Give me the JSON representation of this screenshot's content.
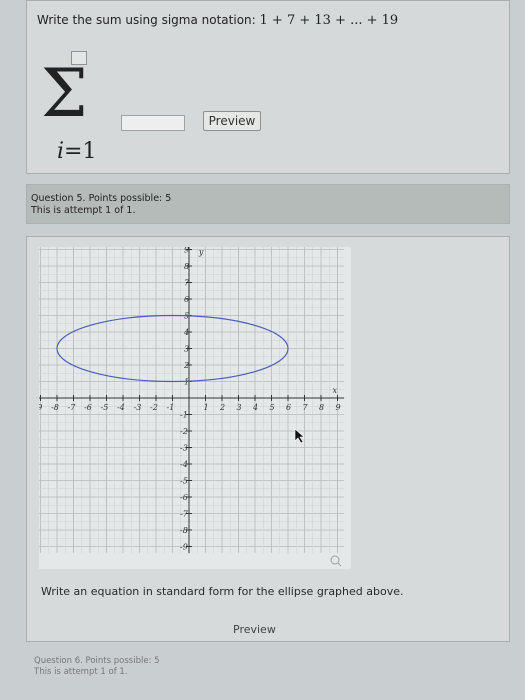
{
  "question4": {
    "prompt_text": "Write the sum using sigma notation: ",
    "series": "1 + 7 + 13 + ... + 19",
    "lower_index": "i",
    "lower_eq": "=1",
    "answer_value": "",
    "preview_label": "Preview"
  },
  "question5": {
    "status_line1": "Question 5. Points possible: 5",
    "status_line2": "This is attempt 1 of 1.",
    "graph": {
      "x_axis_label": "x",
      "y_axis_label": "y",
      "x_ticks": [
        "-9",
        "-8",
        "-7",
        "-6",
        "-5",
        "-4",
        "-3",
        "-2",
        "-1",
        "1",
        "2",
        "3",
        "4",
        "5",
        "6",
        "7",
        "8",
        "9"
      ],
      "y_ticks": [
        "9",
        "8",
        "7",
        "6",
        "5",
        "4",
        "3",
        "2",
        "1",
        "-1",
        "-2",
        "-3",
        "-4",
        "-5",
        "-6",
        "-7",
        "-8",
        "-9"
      ],
      "ellipse": {
        "center_x": -1,
        "center_y": 3,
        "semi_axis_x": 7,
        "semi_axis_y": 2,
        "color": "#4a5dc0"
      },
      "zoom_icon": "magnifier-icon"
    },
    "prompt": "Write an equation in standard form for the ellipse graphed above.",
    "preview_label": "Preview"
  },
  "question6": {
    "status_line1": "Question 6. Points possible: 5",
    "status_line2": "This is attempt 1 of 1."
  }
}
